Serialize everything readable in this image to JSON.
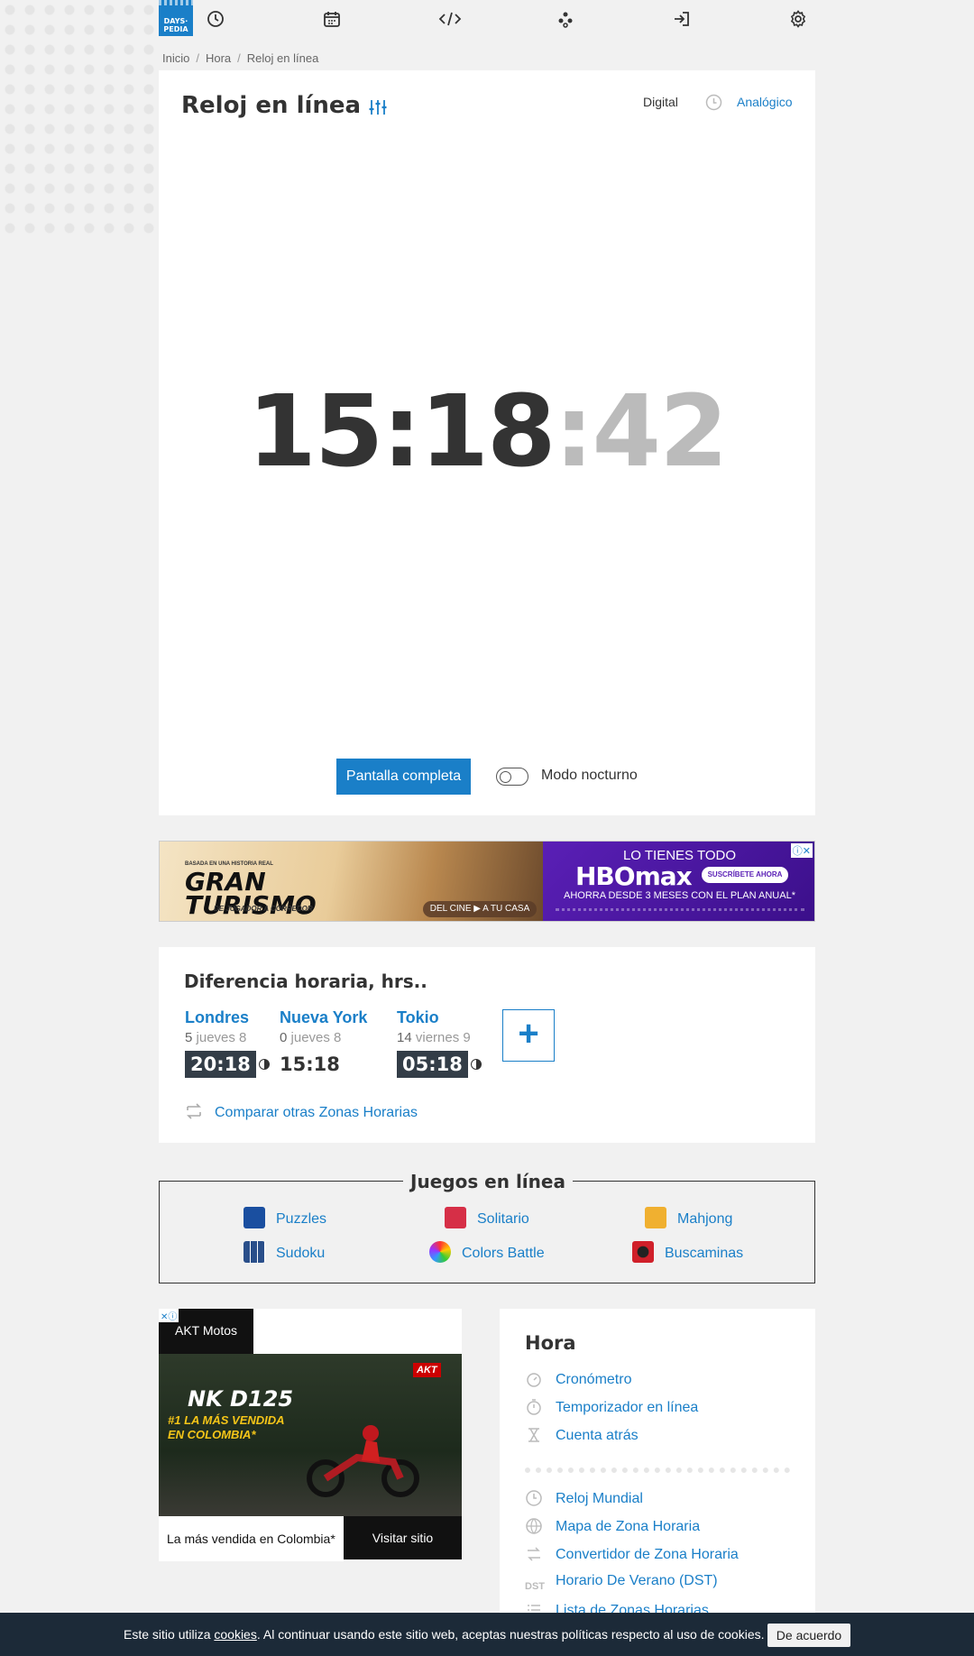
{
  "nav": {
    "logo_line1": "DAYS·",
    "logo_line2": "PEDIA"
  },
  "breadcrumb": [
    "Inicio",
    "Hora",
    "Reloj en línea"
  ],
  "clock": {
    "title": "Reloj en línea",
    "mode_digital": "Digital",
    "mode_analog": "Analógico",
    "time_hm": "15:18",
    "time_sec": ":42",
    "fullscreen_label": "Pantalla completa",
    "night_mode_label": "Modo nocturno"
  },
  "ad_banner": {
    "gt_small": "BASADA EN UNA HISTORIA REAL",
    "gt_title_1": "GRAN",
    "gt_title_2": "TURISMO",
    "gt_sub": "DE JUGADOR A CORREDOR",
    "gt_cine": "DEL CINE ▶ A TU CASA",
    "hb_top": "LO TIENES TODO",
    "hb_logo": "HBOmax",
    "hb_button": "SUSCRÍBETE AHORA",
    "hb_offer": "AHORRA DESDE 3 MESES CON EL PLAN ANUAL*"
  },
  "time_diff": {
    "title": "Diferencia horaria, hrs..",
    "cities": [
      {
        "name": "Londres",
        "offset": "5",
        "day": "jueves 8",
        "time": "20:18"
      },
      {
        "name": "Nueva York",
        "offset": "0",
        "day": "jueves 8",
        "time": "15:18"
      },
      {
        "name": "Tokio",
        "offset": "14",
        "day": "viernes 9",
        "time": "05:18"
      }
    ],
    "add_label": "+",
    "compare_label": "Comparar otras Zonas Horarias"
  },
  "games": {
    "title": "Juegos en línea",
    "items": [
      "Puzzles",
      "Solitario",
      "Mahjong",
      "Sudoku",
      "Colors Battle",
      "Buscaminas"
    ]
  },
  "ad_moto": {
    "brand": "AKT Motos",
    "model": "NK D125",
    "claim": "#1 LA MÁS VENDIDA EN COLOMBIA*",
    "akt_badge": "AKT",
    "footer_text": "La más vendida en Colombia*",
    "visit_label": "Visitar sitio"
  },
  "side_menu": {
    "title": "Hora",
    "items_top": [
      "Cronómetro",
      "Temporizador en línea",
      "Cuenta atrás"
    ],
    "items_bottom": [
      "Reloj Mundial",
      "Mapa de Zona Horaria",
      "Convertidor de Zona Horaria",
      "Horario De Verano (DST)",
      "Lista de Zonas Horarias"
    ]
  },
  "cookie": {
    "text_before": "Este sitio utiliza ",
    "link": "cookies",
    "text_after": ". Al continuar usando este sitio web, aceptas nuestras políticas respecto al uso de cookies.",
    "accept_label": "De acuerdo"
  },
  "colors": {
    "accent": "#1a7fc8",
    "dark": "#333d47",
    "cookie_bg": "#1c2a38"
  }
}
